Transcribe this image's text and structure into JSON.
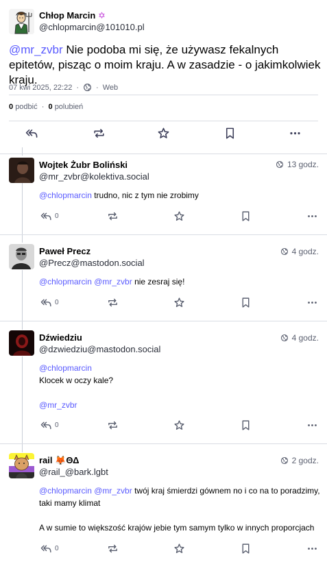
{
  "main_post": {
    "author_name": "Chłop Marcin",
    "author_badge": "✡",
    "author_handle": "@chlopmarcin@101010.pl",
    "mention": "@mr_zvbr",
    "text": " Nie podoba mi się, że używasz fekalnych epitetów, pisząc o moim kraju. A w zasadzie - o jakimkolwiek kraju.",
    "date": "07 kwi 2025, 22:22",
    "sep": "·",
    "client": "Web",
    "boosts_count": "0",
    "boosts_label": "podbić",
    "favs_count": "0",
    "favs_label": "polubień"
  },
  "replies": [
    {
      "author_name": "Wojtek Żubr Boliński",
      "author_handle": "@mr_zvbr@kolektiva.social",
      "time": "13 godz.",
      "mentions": "@chlopmarcin",
      "text": " trudno, nic z tym nie zrobimy",
      "reply_count": "0",
      "avatar_color": "#3a2a22"
    },
    {
      "author_name": "Paweł Precz",
      "author_handle": "@Precz@mastodon.social",
      "time": "4 godz.",
      "mentions": "@chlopmarcin @mr_zvbr",
      "text": " nie zesraj się!",
      "reply_count": "0",
      "avatar_color": "#6d6d6d"
    },
    {
      "author_name": "Dźwiedziu",
      "author_handle": "@dzwiedziu@mastodon.social",
      "time": "4 godz.",
      "line1": "@chlopmarcin",
      "line2": "Klocek w oczy kale?",
      "line3": "@mr_zvbr",
      "reply_count": "0",
      "avatar_color": "#7a0f0f"
    },
    {
      "author_name": "rail",
      "author_badge": "🦊ΘΔ",
      "author_handle": "@rail_@bark.lgbt",
      "time": "2 godz.",
      "mentions": "@chlopmarcin @mr_zvbr",
      "text": " twój kraj śmierdzi gównem no i co na to poradzimy, taki mamy klimat",
      "text2": "A w sumie to większość krajów jebie tym samym tylko w innych proporcjach",
      "reply_count": "0",
      "avatar_color": "#c9a26a"
    }
  ],
  "colors": {
    "accent": "#595aff",
    "icon": "#5b6070",
    "icon_dark": "#3d3f5a",
    "border": "#d9dce3"
  },
  "icons": {
    "reply": "reply-all-icon",
    "boost": "boost-icon",
    "favourite": "star-icon",
    "bookmark": "bookmark-icon",
    "more": "more-icon",
    "visibility": "globe-icon"
  }
}
